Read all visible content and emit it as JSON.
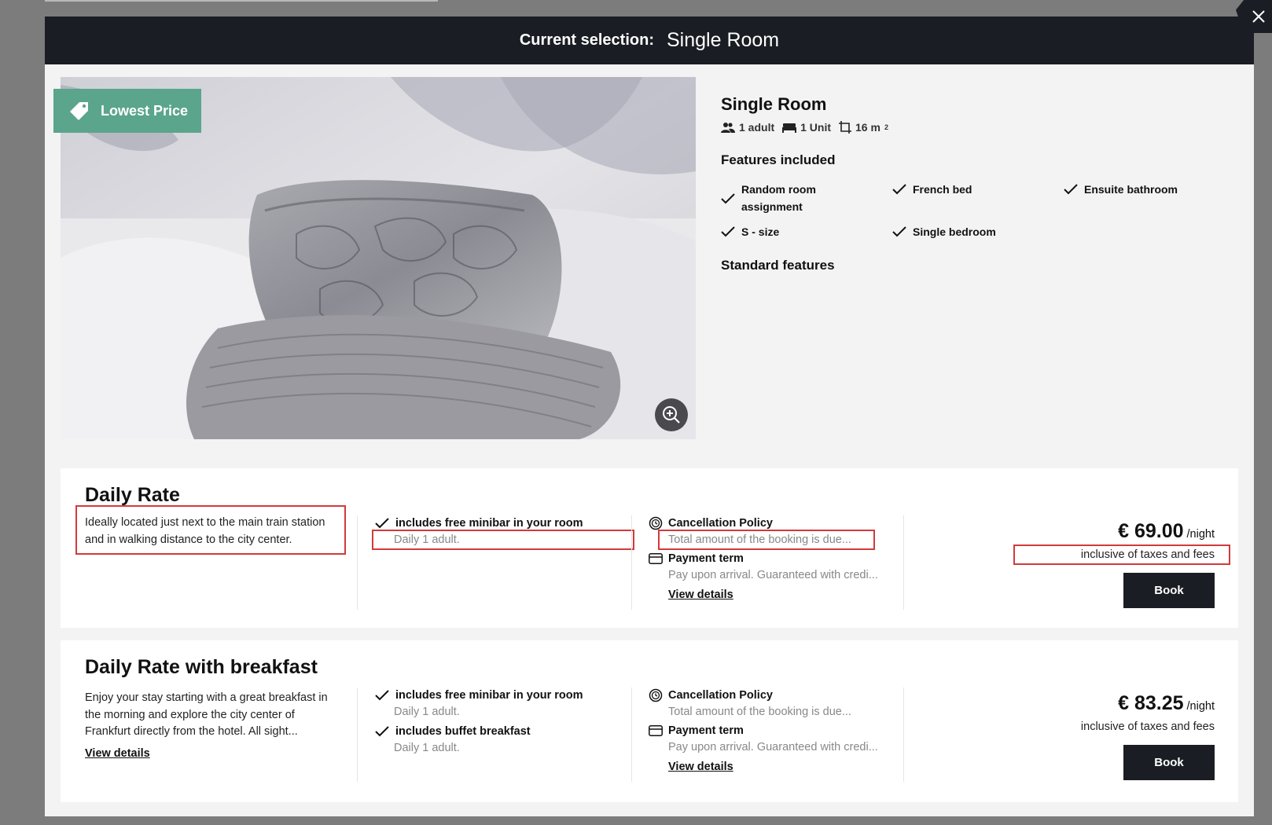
{
  "header": {
    "label": "Current selection:",
    "value": "Single Room"
  },
  "badge": {
    "label": "Lowest Price",
    "icon": "price-tag-icon"
  },
  "room": {
    "title": "Single Room",
    "specs": {
      "adults": "1 adult",
      "units": "1 Unit",
      "size": "16 m",
      "size_unit_sup": "2"
    },
    "features_title": "Features included",
    "features": [
      "Random room assignment",
      "French bed",
      "Ensuite bathroom",
      "S - size",
      "Single bedroom"
    ],
    "standard_title": "Standard features"
  },
  "rates": [
    {
      "title": "Daily Rate",
      "description": "Ideally located just next to the main train station and in walking distance to the city center.",
      "inclusions": [
        {
          "name": "includes free minibar in your room",
          "sub": "Daily 1 adult."
        }
      ],
      "cancellation_title": "Cancellation Policy",
      "cancellation_text": "Total amount of the booking is due...",
      "payment_title": "Payment term",
      "payment_text": "Pay upon arrival. Guaranteed with credi...",
      "view_details": "View details",
      "price": "€ 69.00",
      "per": "/night",
      "price_note": "inclusive of taxes and fees",
      "book_label": "Book"
    },
    {
      "title": "Daily Rate with breakfast",
      "description": "Enjoy your stay starting with a great breakfast in the morning and explore the city center of Frankfurt directly from the hotel. All sight...",
      "description_link": "View details",
      "inclusions": [
        {
          "name": "includes free minibar in your room",
          "sub": "Daily 1 adult."
        },
        {
          "name": "includes buffet breakfast",
          "sub": "Daily 1 adult."
        }
      ],
      "cancellation_title": "Cancellation Policy",
      "cancellation_text": "Total amount of the booking is due...",
      "payment_title": "Payment term",
      "payment_text": "Pay upon arrival. Guaranteed with credi...",
      "view_details": "View details",
      "price": "€ 83.25",
      "per": "/night",
      "price_note": "inclusive of taxes and fees",
      "book_label": "Book"
    }
  ],
  "colors": {
    "header_bg": "#1a1d23",
    "badge_bg": "#5aa58c",
    "highlight": "#d33a3a",
    "overlay": "#7c7c7c"
  }
}
